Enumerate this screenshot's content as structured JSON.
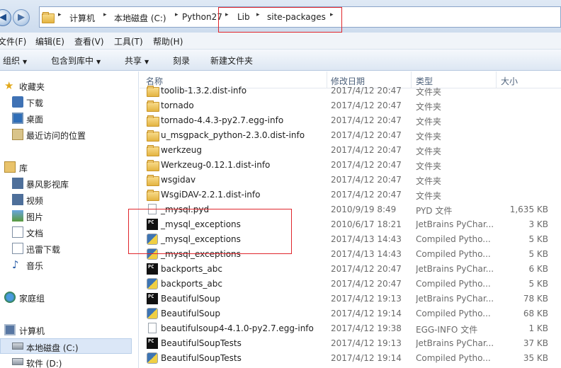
{
  "addressbar": {
    "crumbs": [
      "计算机",
      "本地磁盘 (C:)",
      "Python27",
      "Lib",
      "site-packages"
    ],
    "sep": "▸"
  },
  "menubar": [
    "文件(F)",
    "编辑(E)",
    "查看(V)",
    "工具(T)",
    "帮助(H)"
  ],
  "commandbar": {
    "organize": "组织",
    "include_library": "包含到库中",
    "share": "共享",
    "burn": "刻录",
    "new_folder": "新建文件夹"
  },
  "navpane": {
    "favorites": "收藏夹",
    "downloads": "下载",
    "desktop": "桌面",
    "recent": "最近访问的位置",
    "libraries": "库",
    "storm": "暴风影视库",
    "videos": "视频",
    "pictures": "图片",
    "documents": "文档",
    "xunlei": "迅雷下载",
    "music": "音乐",
    "homegroup": "家庭组",
    "computer": "计算机",
    "local_disk_c": "本地磁盘 (C:)",
    "software_d": "软件 (D:)"
  },
  "columns": {
    "name": "名称",
    "date": "修改日期",
    "type": "类型",
    "size": "大小"
  },
  "files": [
    {
      "icon": "folder",
      "name": "toolib-1.3.2.dist-info",
      "date": "2017/4/12 20:47",
      "type": "文件夹",
      "size": ""
    },
    {
      "icon": "folder",
      "name": "tornado",
      "date": "2017/4/12 20:47",
      "type": "文件夹",
      "size": ""
    },
    {
      "icon": "folder",
      "name": "tornado-4.4.3-py2.7.egg-info",
      "date": "2017/4/12 20:47",
      "type": "文件夹",
      "size": ""
    },
    {
      "icon": "folder",
      "name": "u_msgpack_python-2.3.0.dist-info",
      "date": "2017/4/12 20:47",
      "type": "文件夹",
      "size": ""
    },
    {
      "icon": "folder",
      "name": "werkzeug",
      "date": "2017/4/12 20:47",
      "type": "文件夹",
      "size": ""
    },
    {
      "icon": "folder",
      "name": "Werkzeug-0.12.1.dist-info",
      "date": "2017/4/12 20:47",
      "type": "文件夹",
      "size": ""
    },
    {
      "icon": "folder",
      "name": "wsgidav",
      "date": "2017/4/12 20:47",
      "type": "文件夹",
      "size": ""
    },
    {
      "icon": "folder",
      "name": "WsgiDAV-2.2.1.dist-info",
      "date": "2017/4/12 20:47",
      "type": "文件夹",
      "size": ""
    },
    {
      "icon": "file",
      "name": "_mysql.pyd",
      "date": "2010/9/19 8:49",
      "type": "PYD 文件",
      "size": "1,635 KB"
    },
    {
      "icon": "pycharm",
      "name": "_mysql_exceptions",
      "date": "2010/6/17 18:21",
      "type": "JetBrains PyChar...",
      "size": "3 KB"
    },
    {
      "icon": "python",
      "name": "_mysql_exceptions",
      "date": "2017/4/13 14:43",
      "type": "Compiled Pytho...",
      "size": "5 KB"
    },
    {
      "icon": "python",
      "name": "_mysql_exceptions",
      "date": "2017/4/13 14:43",
      "type": "Compiled Pytho...",
      "size": "5 KB"
    },
    {
      "icon": "pycharm",
      "name": "backports_abc",
      "date": "2017/4/12 20:47",
      "type": "JetBrains PyChar...",
      "size": "6 KB"
    },
    {
      "icon": "python",
      "name": "backports_abc",
      "date": "2017/4/12 20:47",
      "type": "Compiled Pytho...",
      "size": "5 KB"
    },
    {
      "icon": "pycharm",
      "name": "BeautifulSoup",
      "date": "2017/4/12 19:13",
      "type": "JetBrains PyChar...",
      "size": "78 KB"
    },
    {
      "icon": "python",
      "name": "BeautifulSoup",
      "date": "2017/4/12 19:14",
      "type": "Compiled Pytho...",
      "size": "68 KB"
    },
    {
      "icon": "file",
      "name": "beautifulsoup4-4.1.0-py2.7.egg-info",
      "date": "2017/4/12 19:38",
      "type": "EGG-INFO 文件",
      "size": "1 KB"
    },
    {
      "icon": "pycharm",
      "name": "BeautifulSoupTests",
      "date": "2017/4/12 19:13",
      "type": "JetBrains PyChar...",
      "size": "37 KB"
    },
    {
      "icon": "python",
      "name": "BeautifulSoupTests",
      "date": "2017/4/12 19:14",
      "type": "Compiled Pytho...",
      "size": "35 KB"
    }
  ],
  "colors": {
    "highlight_box": "#e0262c",
    "selected_nav": "#dbe7f7"
  }
}
